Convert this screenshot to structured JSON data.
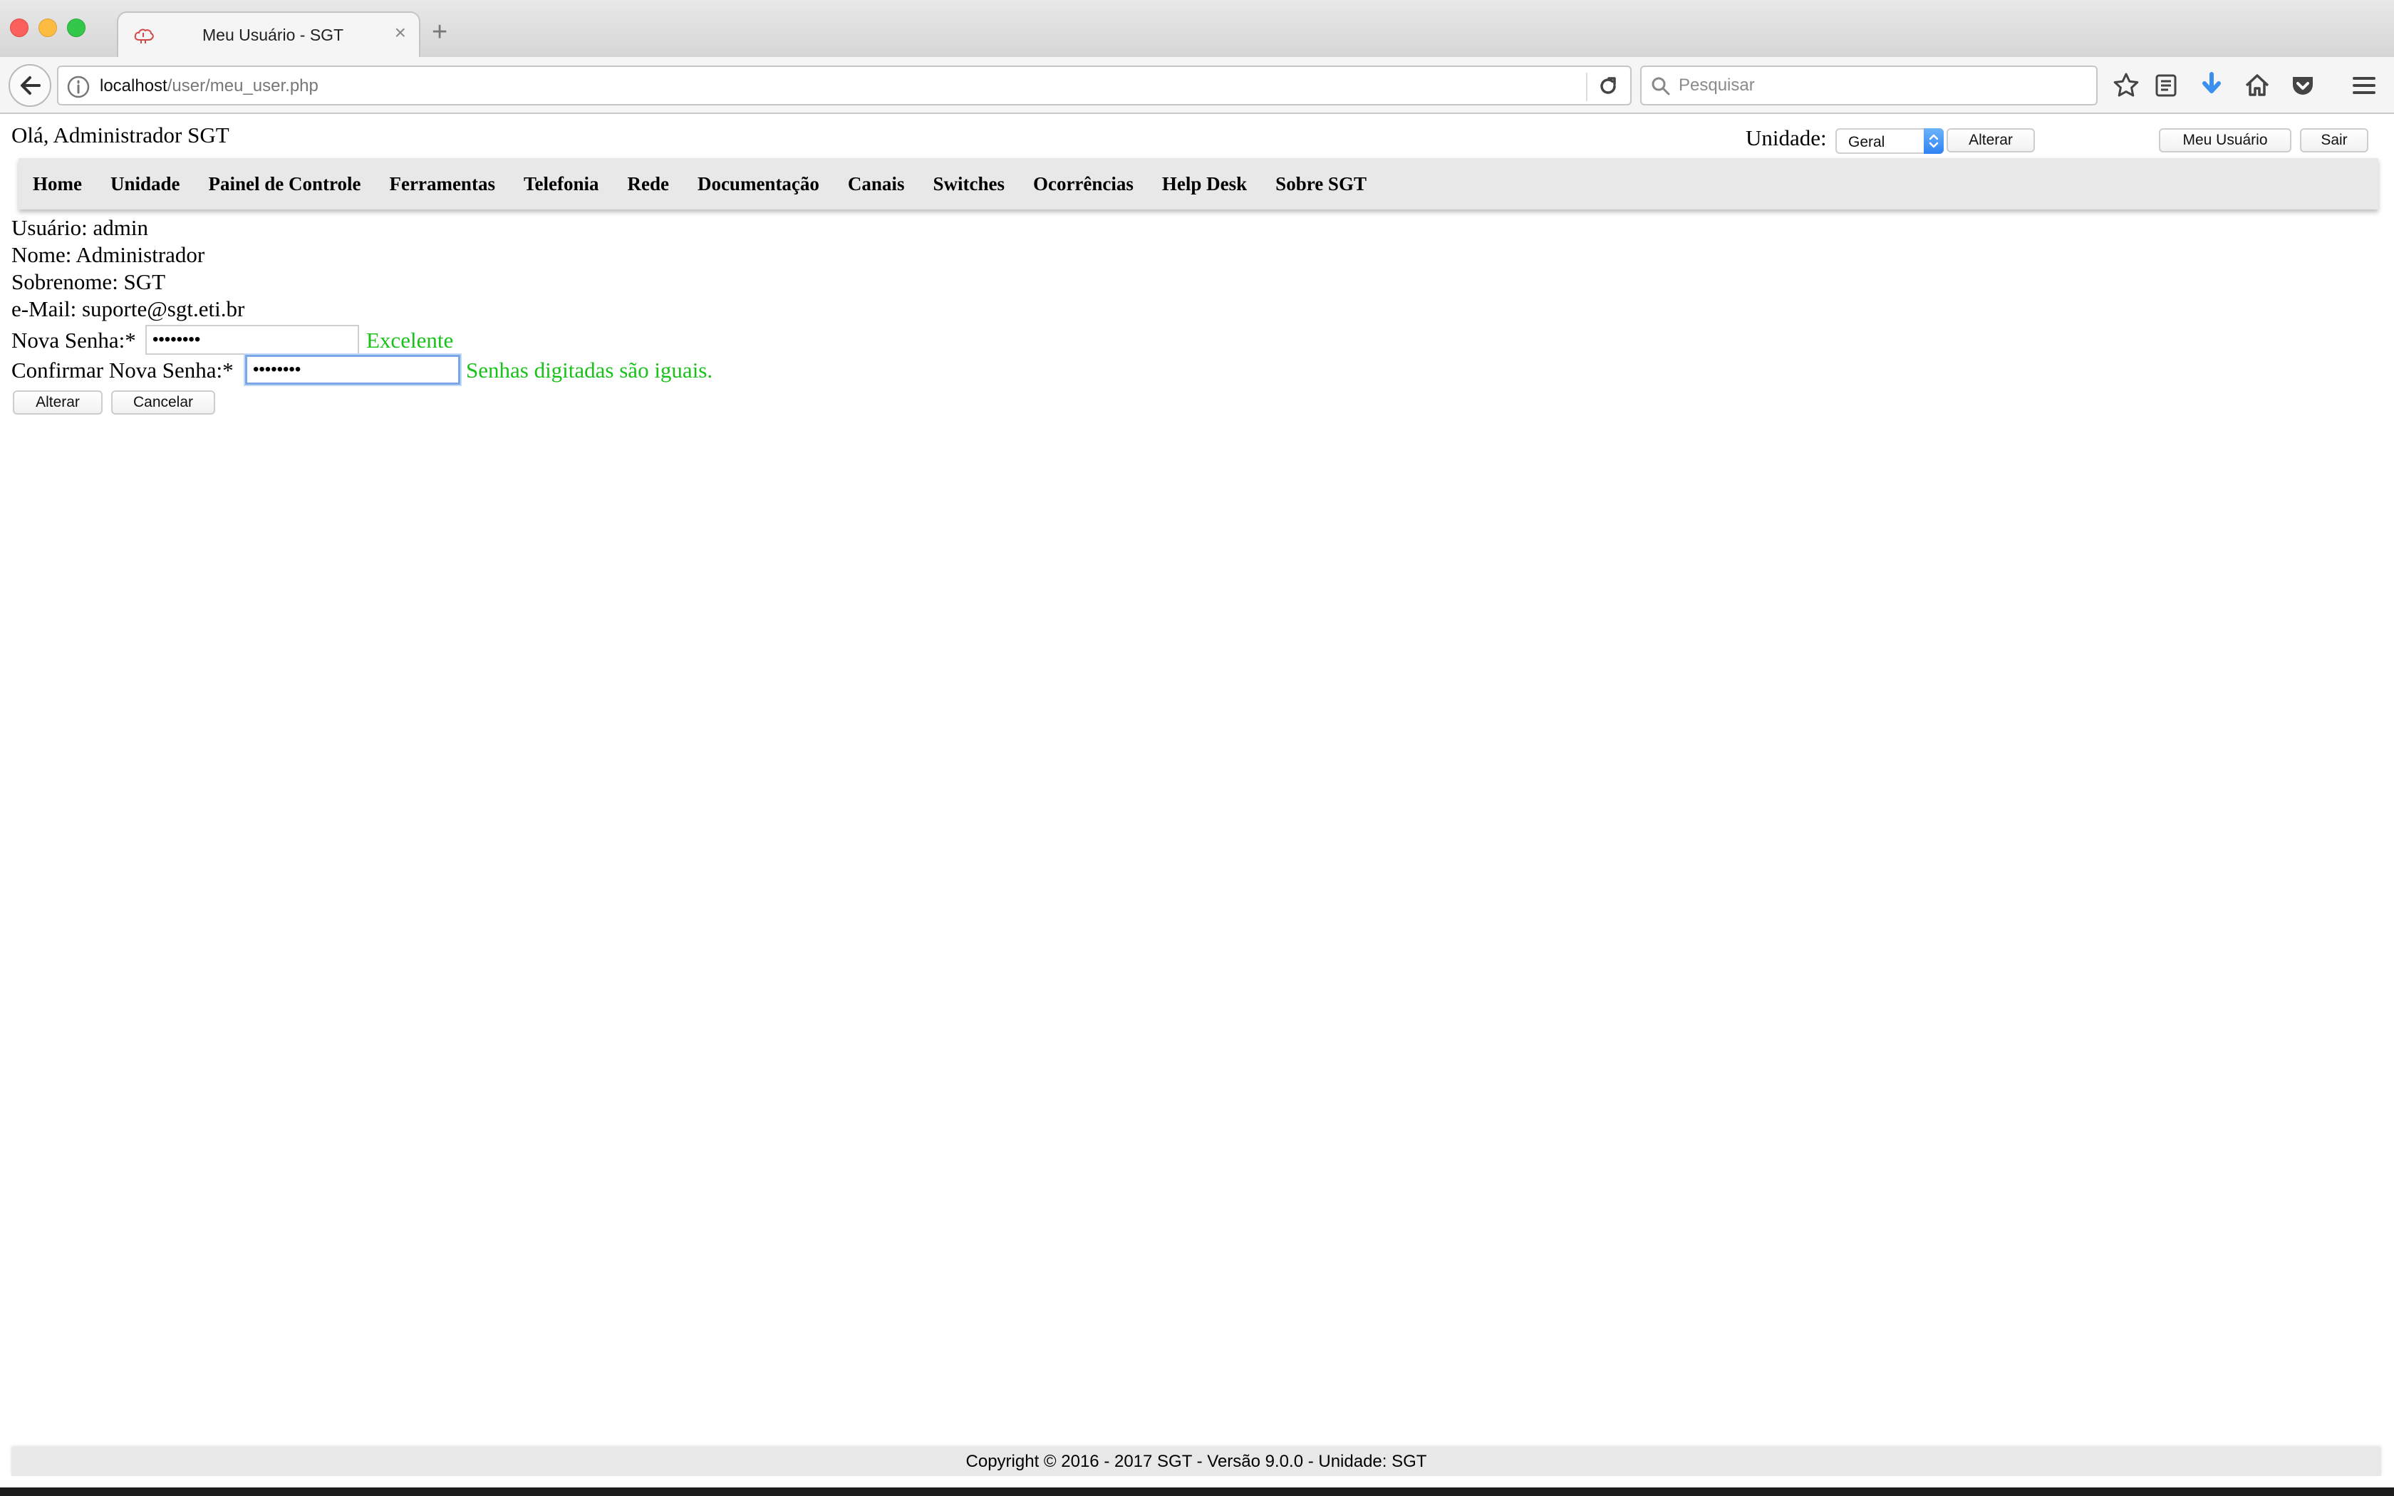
{
  "browser": {
    "tab_title": "Meu Usuário - SGT",
    "tab_close": "×",
    "new_tab": "+",
    "url_host": "localhost",
    "url_path": "/user/meu_user.php",
    "search_placeholder": "Pesquisar"
  },
  "header": {
    "greeting": "Olá, Administrador SGT",
    "unit_label": "Unidade:",
    "unit_selected": "Geral",
    "alterar_label": "Alterar",
    "meu_usuario_label": "Meu Usuário",
    "sair_label": "Sair"
  },
  "menu": {
    "items": [
      {
        "label": "Home"
      },
      {
        "label": "Unidade"
      },
      {
        "label": "Painel de Controle"
      },
      {
        "label": "Ferramentas"
      },
      {
        "label": "Telefonia"
      },
      {
        "label": "Rede"
      },
      {
        "label": "Documentação"
      },
      {
        "label": "Canais"
      },
      {
        "label": "Switches"
      },
      {
        "label": "Ocorrências"
      },
      {
        "label": "Help Desk"
      },
      {
        "label": "Sobre SGT"
      }
    ]
  },
  "user": {
    "usuario": "Usuário: admin",
    "nome": "Nome: Administrador",
    "sobrenome": "Sobrenome: SGT",
    "email": "e-Mail: suporte@sgt.eti.br"
  },
  "form": {
    "new_password_label": "Nova Senha:*",
    "new_password_value": "12345678",
    "new_password_status": "Excelente",
    "confirm_password_label": "Confirmar Nova Senha:*",
    "confirm_password_value": "12345678",
    "confirm_password_status": "Senhas digitadas são iguais.",
    "submit_label": "Alterar",
    "cancel_label": "Cancelar"
  },
  "footer": {
    "copyright": "Copyright © 2016 - 2017 SGT - Versão 9.0.0 - Unidade: SGT"
  },
  "colors": {
    "status_green": "#19c219",
    "menu_bg": "#e8e8e8",
    "select_accent": "#2f83f3"
  }
}
